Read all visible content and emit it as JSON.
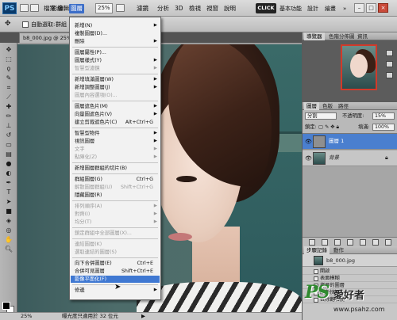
{
  "app": {
    "logo": "PS",
    "menus": [
      "檔案",
      "編輯",
      "影像",
      "圖層",
      "選取",
      "濾鏡",
      "分析",
      "3D",
      "檢視",
      "視窗",
      "說明"
    ],
    "active_menu": "圖層",
    "zoom": "25%",
    "click_label": "CLICK",
    "workspace": [
      "基本功能",
      "設計",
      "繪畫"
    ],
    "window_controls": [
      "–",
      "□",
      "×"
    ]
  },
  "options_bar": {
    "auto_select_label": "自動選取:",
    "auto_select_value": "群組"
  },
  "document": {
    "tab_title": "b8_000.jpg @ 25% (背景, RGB/8)",
    "status_zoom": "25%",
    "status_text": "曝光度只適用於 32 位元"
  },
  "layer_menu": {
    "items": [
      {
        "label": "新增(N)",
        "shortcut": "",
        "submenu": true,
        "disabled": false
      },
      {
        "label": "複製圖層(D)...",
        "shortcut": "",
        "submenu": false,
        "disabled": false
      },
      {
        "label": "刪除",
        "shortcut": "",
        "submenu": true,
        "disabled": false
      },
      {
        "label": "圖層屬性(P)...",
        "shortcut": "",
        "submenu": false,
        "disabled": false
      },
      {
        "label": "圖層樣式(Y)",
        "shortcut": "",
        "submenu": true,
        "disabled": false
      },
      {
        "label": "智慧型濾鏡",
        "shortcut": "",
        "submenu": true,
        "disabled": true
      },
      {
        "label": "新增填滿圖層(W)",
        "shortcut": "",
        "submenu": true,
        "disabled": false
      },
      {
        "label": "新增調整圖層(J)",
        "shortcut": "",
        "submenu": true,
        "disabled": false
      },
      {
        "label": "圖層內容選項(O)...",
        "shortcut": "",
        "submenu": false,
        "disabled": true
      },
      {
        "label": "圖層遮色片(M)",
        "shortcut": "",
        "submenu": true,
        "disabled": false
      },
      {
        "label": "向量圖遮色片(V)",
        "shortcut": "",
        "submenu": true,
        "disabled": false
      },
      {
        "label": "建立剪裁遮色片(C)",
        "shortcut": "Alt+Ctrl+G",
        "submenu": false,
        "disabled": false
      },
      {
        "label": "智慧型物件",
        "shortcut": "",
        "submenu": true,
        "disabled": false
      },
      {
        "label": "視訊圖層",
        "shortcut": "",
        "submenu": true,
        "disabled": false
      },
      {
        "label": "文字",
        "shortcut": "",
        "submenu": true,
        "disabled": true
      },
      {
        "label": "點陣化(Z)",
        "shortcut": "",
        "submenu": true,
        "disabled": true
      },
      {
        "label": "新增圖層群組的切片(B)",
        "shortcut": "",
        "submenu": false,
        "disabled": false
      },
      {
        "label": "群組圖層(G)",
        "shortcut": "Ctrl+G",
        "submenu": false,
        "disabled": false
      },
      {
        "label": "解散圖層群組(U)",
        "shortcut": "Shift+Ctrl+G",
        "submenu": false,
        "disabled": true
      },
      {
        "label": "隱藏圖層(R)",
        "shortcut": "",
        "submenu": false,
        "disabled": false
      },
      {
        "label": "排列順序(A)",
        "shortcut": "",
        "submenu": true,
        "disabled": true
      },
      {
        "label": "對齊(I)",
        "shortcut": "",
        "submenu": true,
        "disabled": true
      },
      {
        "label": "均分(T)",
        "shortcut": "",
        "submenu": true,
        "disabled": true
      },
      {
        "label": "鎖定群組中全部圖層(X)...",
        "shortcut": "",
        "submenu": false,
        "disabled": true
      },
      {
        "label": "連結圖層(K)",
        "shortcut": "",
        "submenu": false,
        "disabled": true
      },
      {
        "label": "選取連結的圖層(S)",
        "shortcut": "",
        "submenu": false,
        "disabled": true
      },
      {
        "label": "向下合併圖層(E)",
        "shortcut": "Ctrl+E",
        "submenu": false,
        "disabled": false
      },
      {
        "label": "合併可見圖層",
        "shortcut": "Shift+Ctrl+E",
        "submenu": false,
        "disabled": false
      },
      {
        "label": "影像平面化(F)",
        "shortcut": "",
        "submenu": false,
        "disabled": false,
        "highlight": true
      },
      {
        "label": "修邊",
        "shortcut": "",
        "submenu": true,
        "disabled": false
      }
    ]
  },
  "navigator": {
    "tabs": [
      "導覽器",
      "色階分佈圖",
      "資訊"
    ],
    "active_tab": "導覽器"
  },
  "layers_panel": {
    "tabs": [
      "圖層",
      "色版",
      "路徑"
    ],
    "active_tab": "圖層",
    "blend_mode": "分割",
    "opacity_label": "不透明度:",
    "opacity_value": "15%",
    "lock_label": "鎖定:",
    "fill_label": "填滿:",
    "fill_value": "100%",
    "layers": [
      {
        "name": "圖層 1",
        "selected": true
      },
      {
        "name": "背景",
        "selected": false
      }
    ]
  },
  "history_panel": {
    "tabs": [
      "步驟記錄",
      "動作"
    ],
    "active_tab": "步驟記錄",
    "snapshot": "b8_000.jpg",
    "steps": [
      "開啟",
      "表面模糊",
      "拷貝的圖層",
      "顏色快調",
      "去除飽和度"
    ]
  },
  "watermark": {
    "ps": "PS",
    "text": "愛好者",
    "url": "www.psahz.com"
  }
}
